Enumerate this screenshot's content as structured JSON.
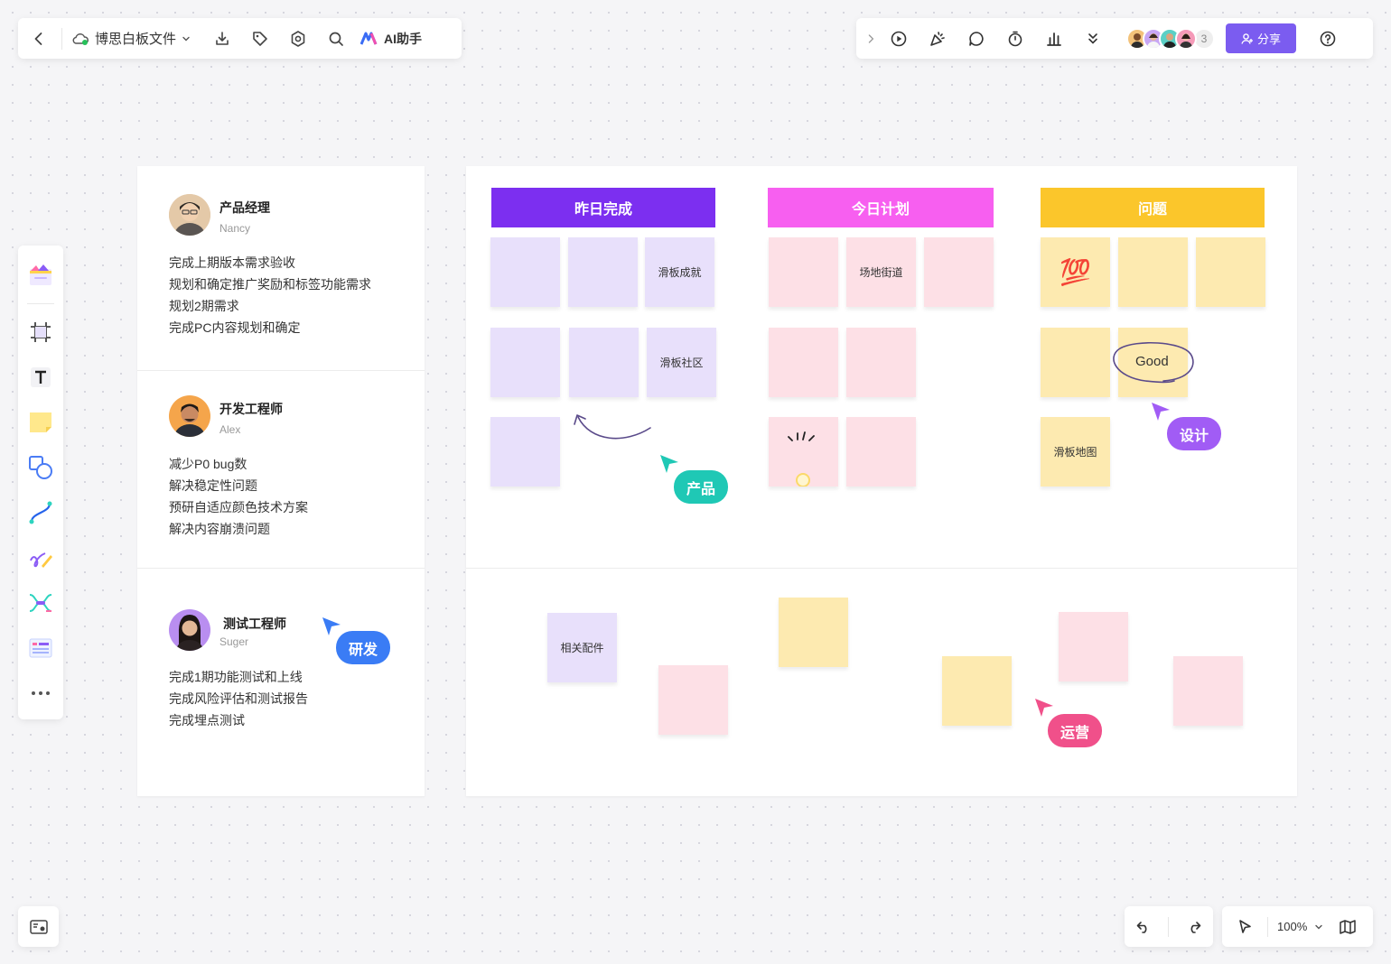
{
  "toolbar": {
    "file_name": "博思白板文件",
    "ai_label": "AI助手",
    "share_label": "分享",
    "collaborators_more": "3"
  },
  "roles": [
    {
      "title": "产品经理",
      "name": "Nancy",
      "tasks": [
        "完成上期版本需求验收",
        "规划和确定推广奖励和标签功能需求",
        "规划2期需求",
        "完成PC内容规划和确定"
      ]
    },
    {
      "title": "开发工程师",
      "name": "Alex",
      "tasks": [
        "减少P0 bug数",
        "解决稳定性问题",
        "预研自适应颜色技术方案",
        "解决内容崩溃问题"
      ]
    },
    {
      "title": "测试工程师",
      "name": "Suger",
      "tasks": [
        "完成1期功能测试和上线",
        "完成风险评估和测试报告",
        "完成埋点测试"
      ]
    }
  ],
  "columns": [
    {
      "title": "昨日完成",
      "color": "#7c2ff0"
    },
    {
      "title": "今日计划",
      "color": "#f75ff0"
    },
    {
      "title": "问题",
      "color": "#fbc62b"
    }
  ],
  "stickies": {
    "huaban_chengjiu": "滑板成就",
    "huaban_shequ": "滑板社区",
    "changdi_jiedao": "场地街道",
    "emoji_100": "💯",
    "good": "Good",
    "huaban_ditu": "滑板地图",
    "xiangguan_peijian": "相关配件"
  },
  "cursors": {
    "product": "产品",
    "design": "设计",
    "research": "研发",
    "operations": "运营"
  },
  "zoom": "100%"
}
